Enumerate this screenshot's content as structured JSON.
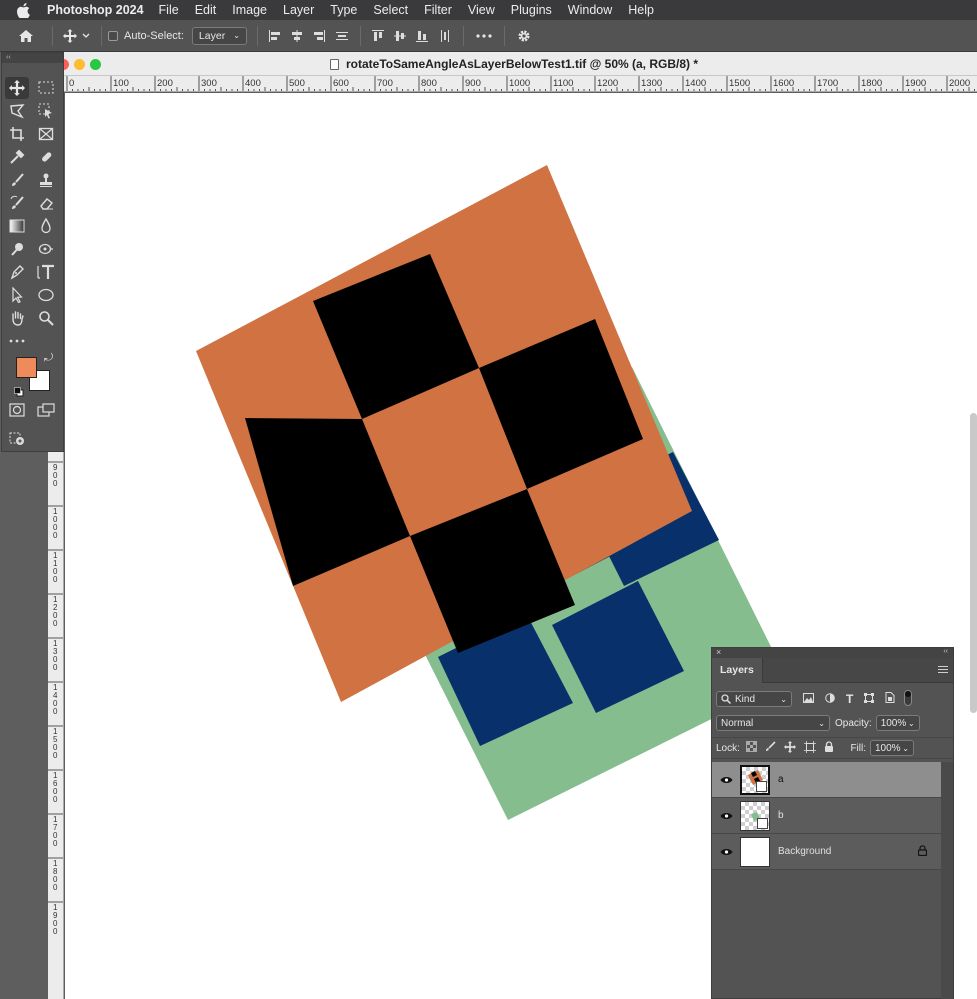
{
  "menubar": {
    "app_name": "Photoshop 2024",
    "items": [
      "File",
      "Edit",
      "Image",
      "Layer",
      "Type",
      "Select",
      "Filter",
      "View",
      "Plugins",
      "Window",
      "Help"
    ]
  },
  "options_bar": {
    "auto_select_label": "Auto-Select:",
    "auto_select_checked": false,
    "auto_select_target": "Layer"
  },
  "document": {
    "title": "rotateToSameAngleAsLayerBelowTest1.tif @ 50% (a, RGB/8) *",
    "ruler_labels": [
      "0",
      "100",
      "200",
      "300",
      "400",
      "500",
      "600",
      "700",
      "800",
      "900",
      "1000",
      "1100",
      "1200",
      "1300",
      "1400",
      "1500",
      "1600",
      "1700",
      "1800",
      "1900",
      "2000"
    ],
    "vertical_ruler_labels": [
      "9 0 0",
      "1 0 0 0",
      "1 1 0 0",
      "1 2 0 0",
      "1 3 0 0",
      "1 4 0 0",
      "1 5 0 0",
      "1 6 0 0",
      "1 7 0 0",
      "1 8 0 0",
      "1 9 0 0"
    ]
  },
  "tools": {
    "foreground_color": "#ef8a5a",
    "background_color": "#ffffff"
  },
  "artwork": {
    "top_layer_colors": [
      "#d07242",
      "#000000"
    ],
    "bottom_layer_colors": [
      "#86bd8f",
      "#08316b"
    ]
  },
  "layers_panel": {
    "tab_label": "Layers",
    "filter_kind": "Kind",
    "blend_mode": "Normal",
    "opacity_label": "Opacity:",
    "opacity_value": "100%",
    "lock_label": "Lock:",
    "fill_label": "Fill:",
    "fill_value": "100%",
    "layers": [
      {
        "name": "a",
        "selected": true
      },
      {
        "name": "b",
        "selected": false
      },
      {
        "name": "Background",
        "selected": false,
        "locked": true
      }
    ]
  }
}
